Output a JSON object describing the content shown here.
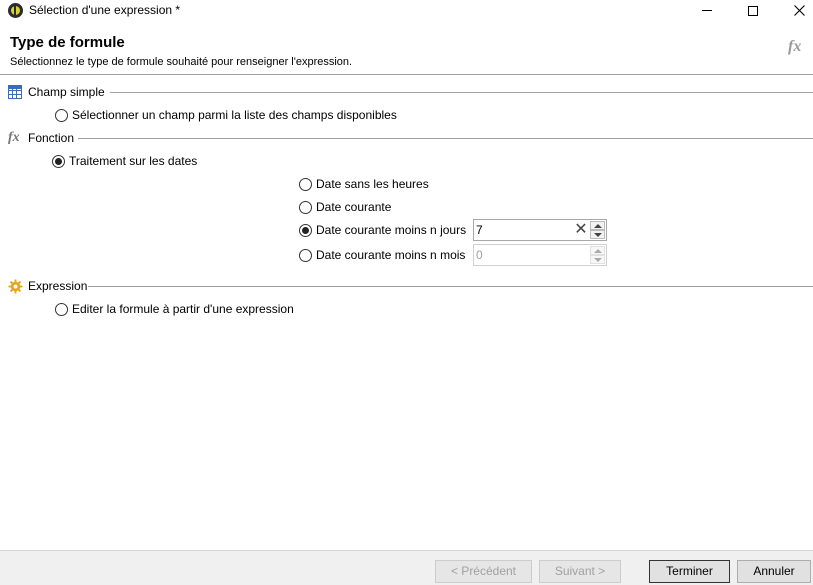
{
  "window": {
    "title": "Sélection d'une expression *"
  },
  "header": {
    "title": "Type de formule",
    "subtitle": "Sélectionnez le type de formule souhaité pour renseigner l'expression.",
    "icon": "fx-icon"
  },
  "sections": {
    "champ_simple": {
      "label": "Champ simple",
      "icon": "grid-icon",
      "option": {
        "label": "Sélectionner un champ parmi la liste des champs disponibles",
        "checked": false
      }
    },
    "fonction": {
      "label": "Fonction",
      "icon": "fx-icon",
      "option": {
        "label": "Traitement sur les dates",
        "checked": true
      },
      "sub_options": [
        {
          "label": "Date sans les heures",
          "checked": false
        },
        {
          "label": "Date courante",
          "checked": false
        },
        {
          "label": "Date courante moins n jours",
          "checked": true,
          "value": "7",
          "enabled": true
        },
        {
          "label": "Date courante moins n mois",
          "checked": false,
          "value": "0",
          "enabled": false
        }
      ]
    },
    "expression": {
      "label": "Expression",
      "icon": "gear-icon",
      "option": {
        "label": "Editer la formule à partir d'une expression",
        "checked": false
      }
    }
  },
  "footer": {
    "previous": "< Précédent",
    "next": "Suivant >",
    "finish": "Terminer",
    "cancel": "Annuler"
  },
  "colors": {
    "section_icon_blue": "#3b6db0",
    "gear_orange": "#e8a317",
    "separator": "#a0a0a0"
  }
}
